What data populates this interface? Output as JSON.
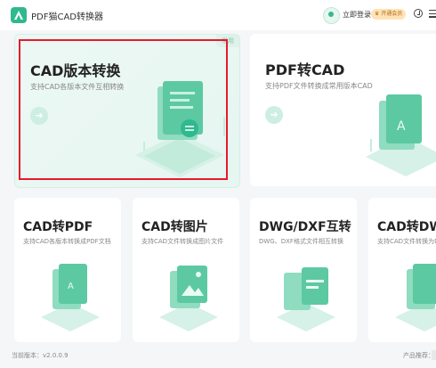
{
  "app": {
    "title": "PDF猫CAD转换器"
  },
  "header": {
    "login": "立即登录",
    "vip": "开通会员"
  },
  "cards": {
    "cad_version": {
      "title": "CAD版本转换",
      "desc": "支持CAD各版本文件互相转换",
      "badge": "常用"
    },
    "pdf_to_cad": {
      "title": "PDF转CAD",
      "desc": "支持PDF文件转换成常用版本CAD"
    },
    "cad_to_pdf": {
      "title": "CAD转PDF",
      "desc": "支持CAD各版本转换成PDF文档"
    },
    "cad_to_image": {
      "title": "CAD转图片",
      "desc": "支持CAD文件转换成图片文件"
    },
    "dwg_dxf": {
      "title": "DWG/DXF互转",
      "desc": "DWG、DXF格式文件相互转换"
    },
    "cad_to_dwf": {
      "title": "CAD转DWF",
      "desc": "支持CAD文件转换为DWF"
    }
  },
  "footer": {
    "version": "当前版本：v2.0.0.9",
    "recommend": "产品推荐："
  },
  "colors": {
    "accent": "#2fb98e",
    "highlight_border": "#e8192c"
  }
}
